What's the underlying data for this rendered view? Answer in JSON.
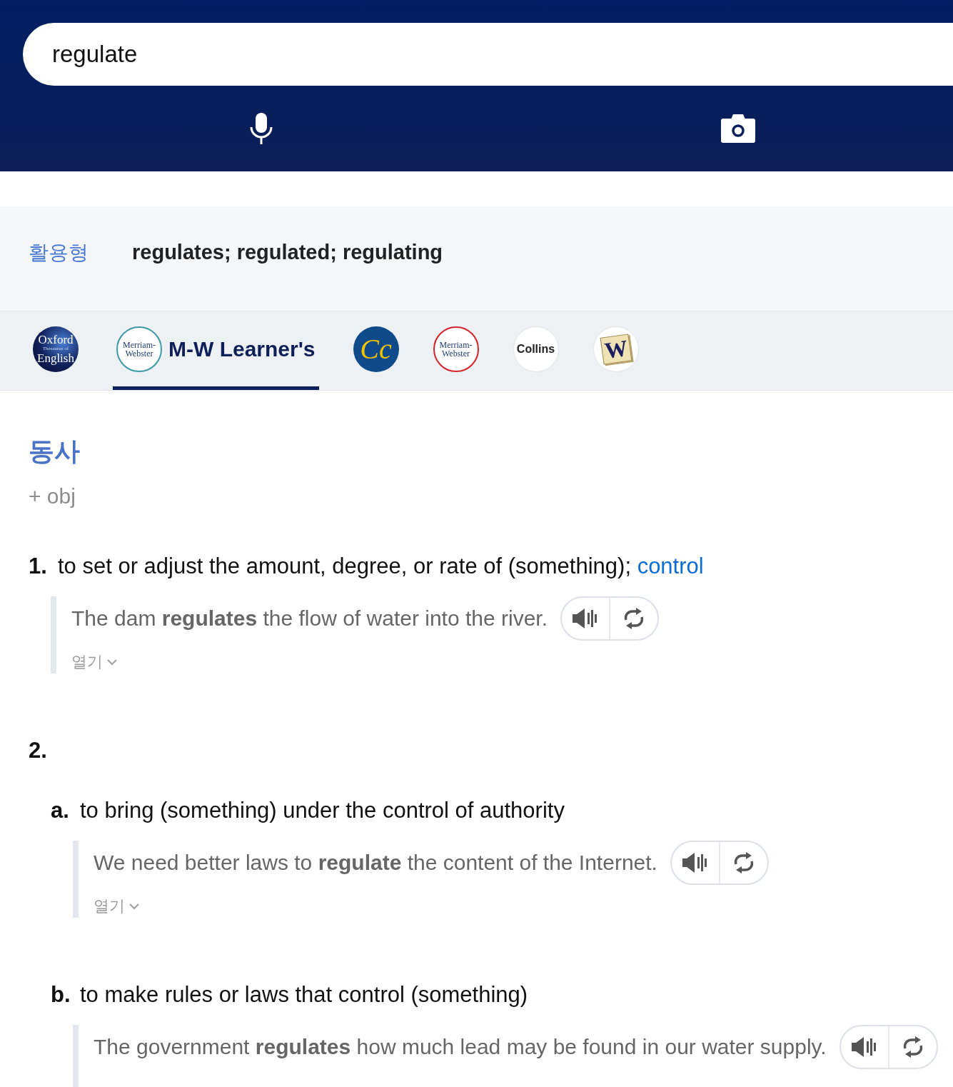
{
  "search": {
    "value": "regulate"
  },
  "forms": {
    "label": "활용형",
    "value": "regulates; regulated; regulating"
  },
  "dictionary_tabs": [
    {
      "kind": "oxford",
      "logo_text": [
        "Oxford",
        "Thesaurus of",
        "English"
      ],
      "selected": false
    },
    {
      "kind": "learners",
      "logo_text": [
        "Merriam-",
        "Webster"
      ],
      "label": "M-W Learner's",
      "selected": true
    },
    {
      "kind": "cc",
      "logo_text": [
        "Cc"
      ],
      "selected": false
    },
    {
      "kind": "merriam",
      "logo_text": [
        "Merriam-",
        "Webster"
      ],
      "selected": false
    },
    {
      "kind": "collins",
      "logo_text": [
        "Collins"
      ],
      "selected": false
    },
    {
      "kind": "tile",
      "logo_text": [
        "W"
      ],
      "selected": false
    }
  ],
  "entry": {
    "part_of_speech": "동사",
    "grammar": "+ obj",
    "senses": [
      {
        "number": "1.",
        "text": "to set or adjust the amount, degree, or rate of (something);",
        "link": "control",
        "examples": [
          {
            "text": "The dam **regulates** the flow of water into the river.",
            "expand": "열기"
          }
        ]
      },
      {
        "number": "2.",
        "children": [
          {
            "number": "a.",
            "text": "to bring (something) under the control of authority",
            "examples": [
              {
                "text": "We need better laws to **regulate** the content of the Internet.",
                "expand": "열기"
              }
            ]
          },
          {
            "number": "b.",
            "text": "to make rules or laws that control (something)",
            "examples": [
              {
                "text": "The government **regulates** how much lead may be found in our water supply."
              }
            ]
          }
        ]
      }
    ]
  }
}
